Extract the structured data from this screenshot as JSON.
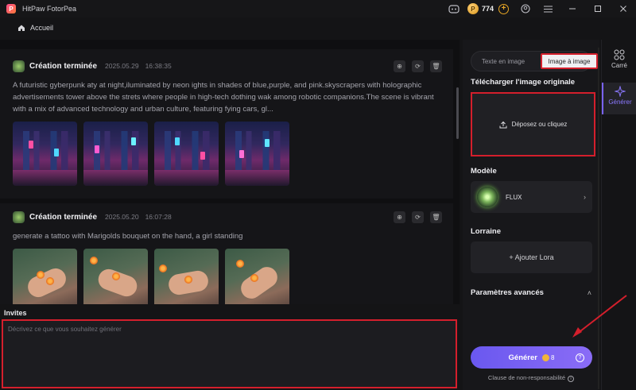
{
  "app": {
    "title": "HitPaw FotorPea",
    "logo_letter": "P"
  },
  "titlebar": {
    "credits": "774",
    "plus_label": "+"
  },
  "breadcrumb": {
    "home": "Accueil"
  },
  "feed": {
    "cards": [
      {
        "title": "Création terminée",
        "date": "2025.05.29",
        "time": "16:38:35",
        "prompt": "A futuristic gyberpunk aty at night,iluminated by neon ights in shades of blue,purple, and pink.skyscrapers with holographic advertisements tower above the strets where people in high-tech dothing wak among robotic companions.The scene is vibrant with a mix of advanced technology and urban culture, featuring fying cars, gl..."
      },
      {
        "title": "Création terminée",
        "date": "2025.05.20",
        "time": "16:07:28",
        "prompt": "generate a tattoo with Marigolds bouquet on the hand, a girl standing"
      }
    ]
  },
  "invites": {
    "label": "Invites",
    "placeholder": "Décrivez ce que vous souhaitez générer"
  },
  "panel": {
    "tabs": [
      "Texte en image",
      "Image à image"
    ],
    "active_tab": "Image à image",
    "upload_title": "Télécharger l'image originale",
    "upload_label": "Déposez ou cliquez",
    "model_title": "Modèle",
    "model_name": "FLUX",
    "lora_title": "Lorraine",
    "lora_button": "+ Ajouter Lora",
    "advanced_title": "Paramètres avancés",
    "generate_label": "Générer",
    "generate_cost": "8",
    "disclaimer": "Clause de non-responsabilité"
  },
  "rail": {
    "items": [
      {
        "label": "Carré",
        "icon": "grid-icon"
      },
      {
        "label": "Générer",
        "icon": "sparkle-icon"
      }
    ]
  },
  "colors": {
    "accent": "#7a63ff",
    "highlight": "#d41f2c",
    "coin": "#e8a624"
  }
}
